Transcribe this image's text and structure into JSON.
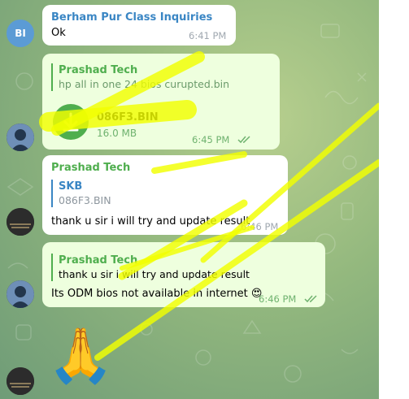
{
  "colors": {
    "incoming_name": "#3a86c4",
    "outgoing_accent": "#4fae4e",
    "time_in": "#a0a8b0",
    "time_out": "#6fb26f",
    "highlighter": "#f2ff00",
    "initials_avatar": "#5b9bd5"
  },
  "messages": [
    {
      "sender": "Berham Pur Class Inquiries",
      "avatar_initials": "BI",
      "text": "Ok",
      "time": "6:41 PM"
    },
    {
      "sender": "Prashad Tech",
      "reply_text": "hp all in one 24 bios curupted.bin",
      "file_name": "086F3.BIN",
      "file_size": "16.0 MB",
      "time": "6:45 PM",
      "icon": "download-icon"
    },
    {
      "sender": "Prashad Tech",
      "reply_name": "SKB",
      "reply_text": "086F3.BIN",
      "text": "thank u sir i will try and update result",
      "time": "6:46 PM"
    },
    {
      "sender": "Prashad Tech",
      "reply_text": "thank u sir i will try and update result",
      "text": "Its ODM bios not available in internet",
      "emoji": "😍",
      "time": "6:46 PM"
    },
    {
      "emoji": "🙏"
    }
  ]
}
